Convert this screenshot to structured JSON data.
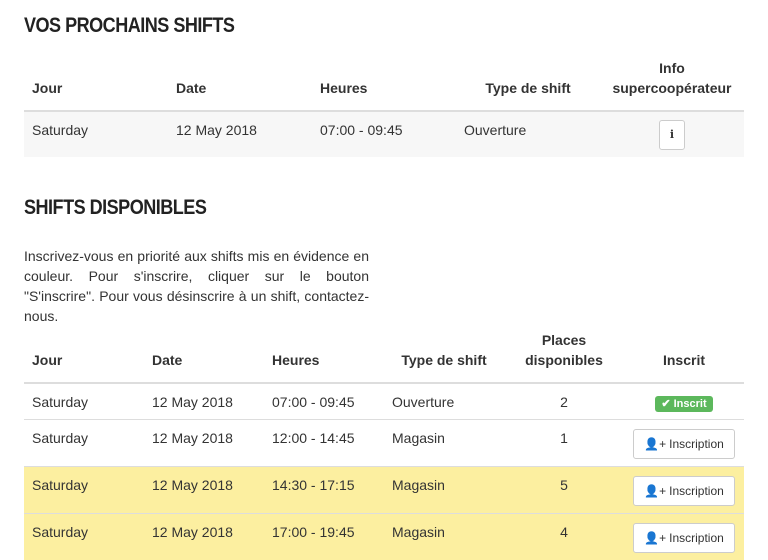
{
  "next_shifts": {
    "title": "Vos prochains shifts",
    "headers": {
      "day": "Jour",
      "date": "Date",
      "hours": "Heures",
      "type": "Type de shift",
      "info_line1": "Info",
      "info_line2": "supercoopérateur"
    },
    "rows": [
      {
        "day": "Saturday",
        "date": "12 May 2018",
        "hours": "07:00 - 09:45",
        "type": "Ouverture",
        "info_icon": "info-icon",
        "info_glyph": "i"
      }
    ]
  },
  "available_shifts": {
    "title": "Shifts disponibles",
    "intro": "Inscrivez-vous en priorité aux shifts mis en évidence en couleur. Pour s'inscrire, cliquer sur le bouton \"S'inscrire\". Pour vous désinscrire à un shift, contactez-nous.",
    "headers": {
      "day": "Jour",
      "date": "Date",
      "hours": "Heures",
      "type": "Type de shift",
      "places_line1": "Places",
      "places_line2": "disponibles",
      "registered": "Inscrit"
    },
    "rows": [
      {
        "day": "Saturday",
        "date": "12 May 2018",
        "hours": "07:00 - 09:45",
        "type": "Ouverture",
        "places": "2",
        "status": "Inscrit",
        "highlight": false
      },
      {
        "day": "Saturday",
        "date": "12 May 2018",
        "hours": "12:00 - 14:45",
        "type": "Magasin",
        "places": "1",
        "action": "Inscription",
        "highlight": false
      },
      {
        "day": "Saturday",
        "date": "12 May 2018",
        "hours": "14:30 - 17:15",
        "type": "Magasin",
        "places": "5",
        "action": "Inscription",
        "highlight": true
      },
      {
        "day": "Saturday",
        "date": "12 May 2018",
        "hours": "17:00 - 19:45",
        "type": "Magasin",
        "places": "4",
        "action": "Inscription",
        "highlight": true
      }
    ],
    "icons": {
      "registered_icon": "check-icon",
      "add_user_icon": "user-plus-icon"
    },
    "colors": {
      "highlight": "#fcefa0",
      "success": "#5cb85c"
    }
  }
}
